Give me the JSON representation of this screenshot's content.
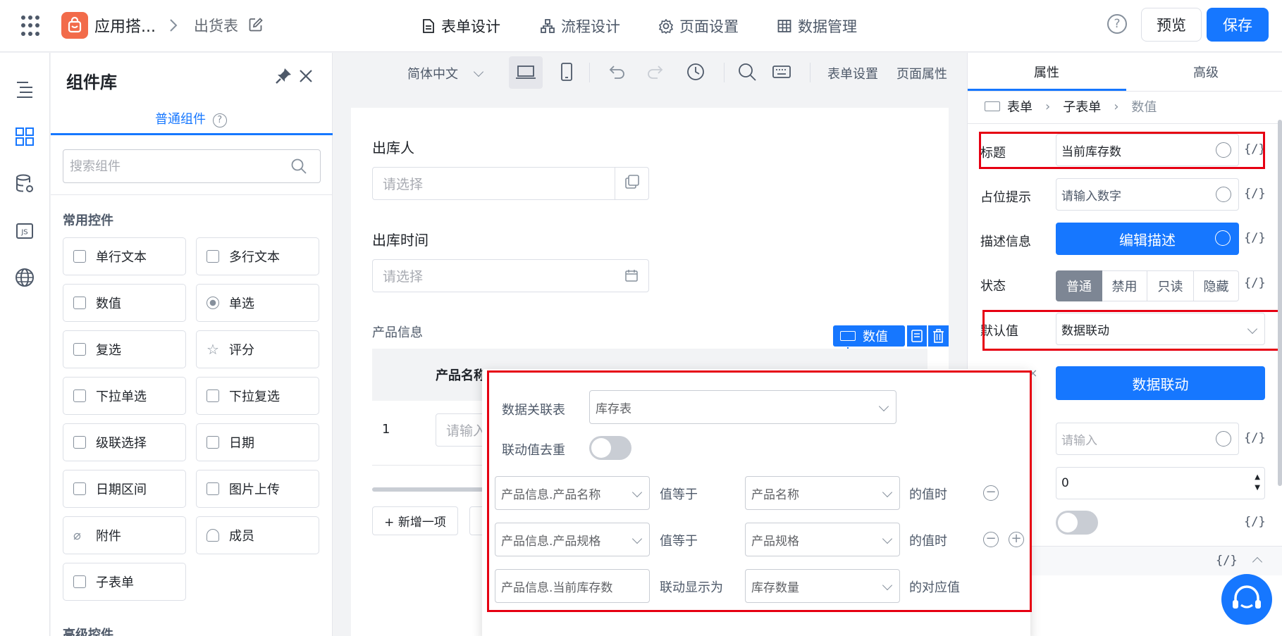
{
  "topbar": {
    "app_name": "应用搭...",
    "page_name": "出货表",
    "nav": [
      "表单设计",
      "流程设计",
      "页面设置",
      "数据管理"
    ],
    "help": "?",
    "preview": "预览",
    "save": "保存"
  },
  "library": {
    "title": "组件库",
    "tab": "普通组件",
    "search_placeholder": "搜索组件",
    "section_common": "常用控件",
    "components": [
      "单行文本",
      "多行文本",
      "数值",
      "单选",
      "复选",
      "评分",
      "下拉单选",
      "下拉复选",
      "级联选择",
      "日期",
      "日期区间",
      "图片上传",
      "附件",
      "成员",
      "子表单"
    ],
    "section_advanced": "高级控件"
  },
  "toolbar": {
    "language": "简体中文",
    "form_settings": "表单设置",
    "page_props": "页面属性"
  },
  "canvas": {
    "field1_label": "出库人",
    "field1_placeholder": "请选择",
    "field2_label": "出库时间",
    "field2_placeholder": "请选择",
    "subform_label": "产品信息",
    "col_product_name": "产品名称",
    "row_index": "1",
    "row_placeholder": "请输入",
    "add_item": "+ 新增一项",
    "selected_tag": "数值"
  },
  "props": {
    "tabs": [
      "属性",
      "高级"
    ],
    "breadcrumb": [
      "表单",
      "子表单",
      "数值"
    ],
    "title_label": "标题",
    "title_value": "当前库存数",
    "placeholder_label": "占位提示",
    "placeholder_value": "请输入数字",
    "desc_label": "描述信息",
    "desc_button": "编辑描述",
    "state_label": "状态",
    "states": [
      "普通",
      "禁用",
      "只读",
      "隐藏"
    ],
    "default_label": "默认值",
    "default_value": "数据联动",
    "linkage_button": "数据联动",
    "input_placeholder": "请输入",
    "number_value": "0",
    "fx": "{/}"
  },
  "popover": {
    "table_label": "数据关联表",
    "table_value": "库存表",
    "dedup_label": "联动值去重",
    "rules": [
      {
        "left": "产品信息.产品名称",
        "op": "值等于",
        "right": "产品名称",
        "suffix": "的值时"
      },
      {
        "left": "产品信息.产品规格",
        "op": "值等于",
        "right": "产品规格",
        "suffix": "的值时"
      },
      {
        "left": "产品信息.当前库存数",
        "op": "联动显示为",
        "right": "库存数量",
        "suffix": "的对应值"
      }
    ]
  },
  "colors": {
    "primary": "#1677ff",
    "highlight": "#e60012",
    "segment_active": "#7d8694"
  }
}
